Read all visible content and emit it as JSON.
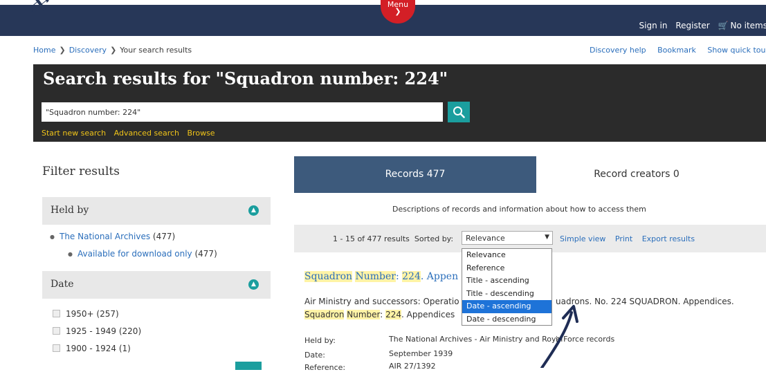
{
  "header": {
    "menu_label": "Menu",
    "links": [
      "Sign in",
      "Register",
      "No items"
    ]
  },
  "breadcrumb": {
    "items": [
      "Home",
      "Discovery",
      "Your search results"
    ],
    "help_links": [
      "Discovery help",
      "Bookmark",
      "Show quick tour"
    ]
  },
  "search": {
    "heading": "Search results for \"Squadron number: 224\"",
    "query": "\"Squadron number: 224\"",
    "links": [
      "Start new search",
      "Advanced search",
      "Browse"
    ]
  },
  "filters": {
    "title": "Filter results",
    "held_by": {
      "label": "Held by",
      "item": "The National Archives",
      "item_count": "(477)",
      "sub_item": "Available for download only",
      "sub_count": "(477)"
    },
    "date": {
      "label": "Date",
      "items": [
        "1950+ (257)",
        "1925 - 1949 (220)",
        "1900 - 1924 (1)"
      ]
    }
  },
  "tabs": {
    "records": "Records 477",
    "creators": "Record creators 0",
    "description": "Descriptions of records and information about how to access them"
  },
  "sorting": {
    "results_count": "1 - 15 of 477 results",
    "sorted_by_label": "Sorted by:",
    "selected": "Relevance",
    "options": [
      "Relevance",
      "Reference",
      "Title - ascending",
      "Title - descending",
      "Date - ascending",
      "Date - descending"
    ],
    "highlighted_option": "Date - ascending",
    "links": [
      "Simple view",
      "Print",
      "Export results"
    ]
  },
  "result": {
    "title_parts": [
      "Squadron",
      " ",
      "Number",
      ": ",
      "224",
      ". Appen"
    ],
    "line1_start": "Air Ministry and successors: Operatio",
    "line1_end": "uadrons. No. 224 SQUADRON. Appendices.",
    "line2_parts": [
      "Squadron",
      " ",
      "Number",
      ": ",
      "224",
      ". Appendices"
    ],
    "held_by_label": "Held by:",
    "held_by_value_a": "The National Archives - Air Ministry and Royal",
    "held_by_value_b": "ir Force records",
    "date_label": "Date:",
    "date_value": "September 1939",
    "reference_label": "Reference:",
    "reference_value": "AIR 27/1392"
  },
  "colors": {
    "header_bg": "#273758",
    "menu_red": "#d31f26",
    "banner_bg": "#2b2b2b",
    "teal": "#1b9e9e",
    "tab_active": "#3d5a7c",
    "link": "#2a6ebb",
    "highlight": "#fff3a6",
    "option_selected": "#1e73d8",
    "yellow_links": "#f0c419"
  }
}
